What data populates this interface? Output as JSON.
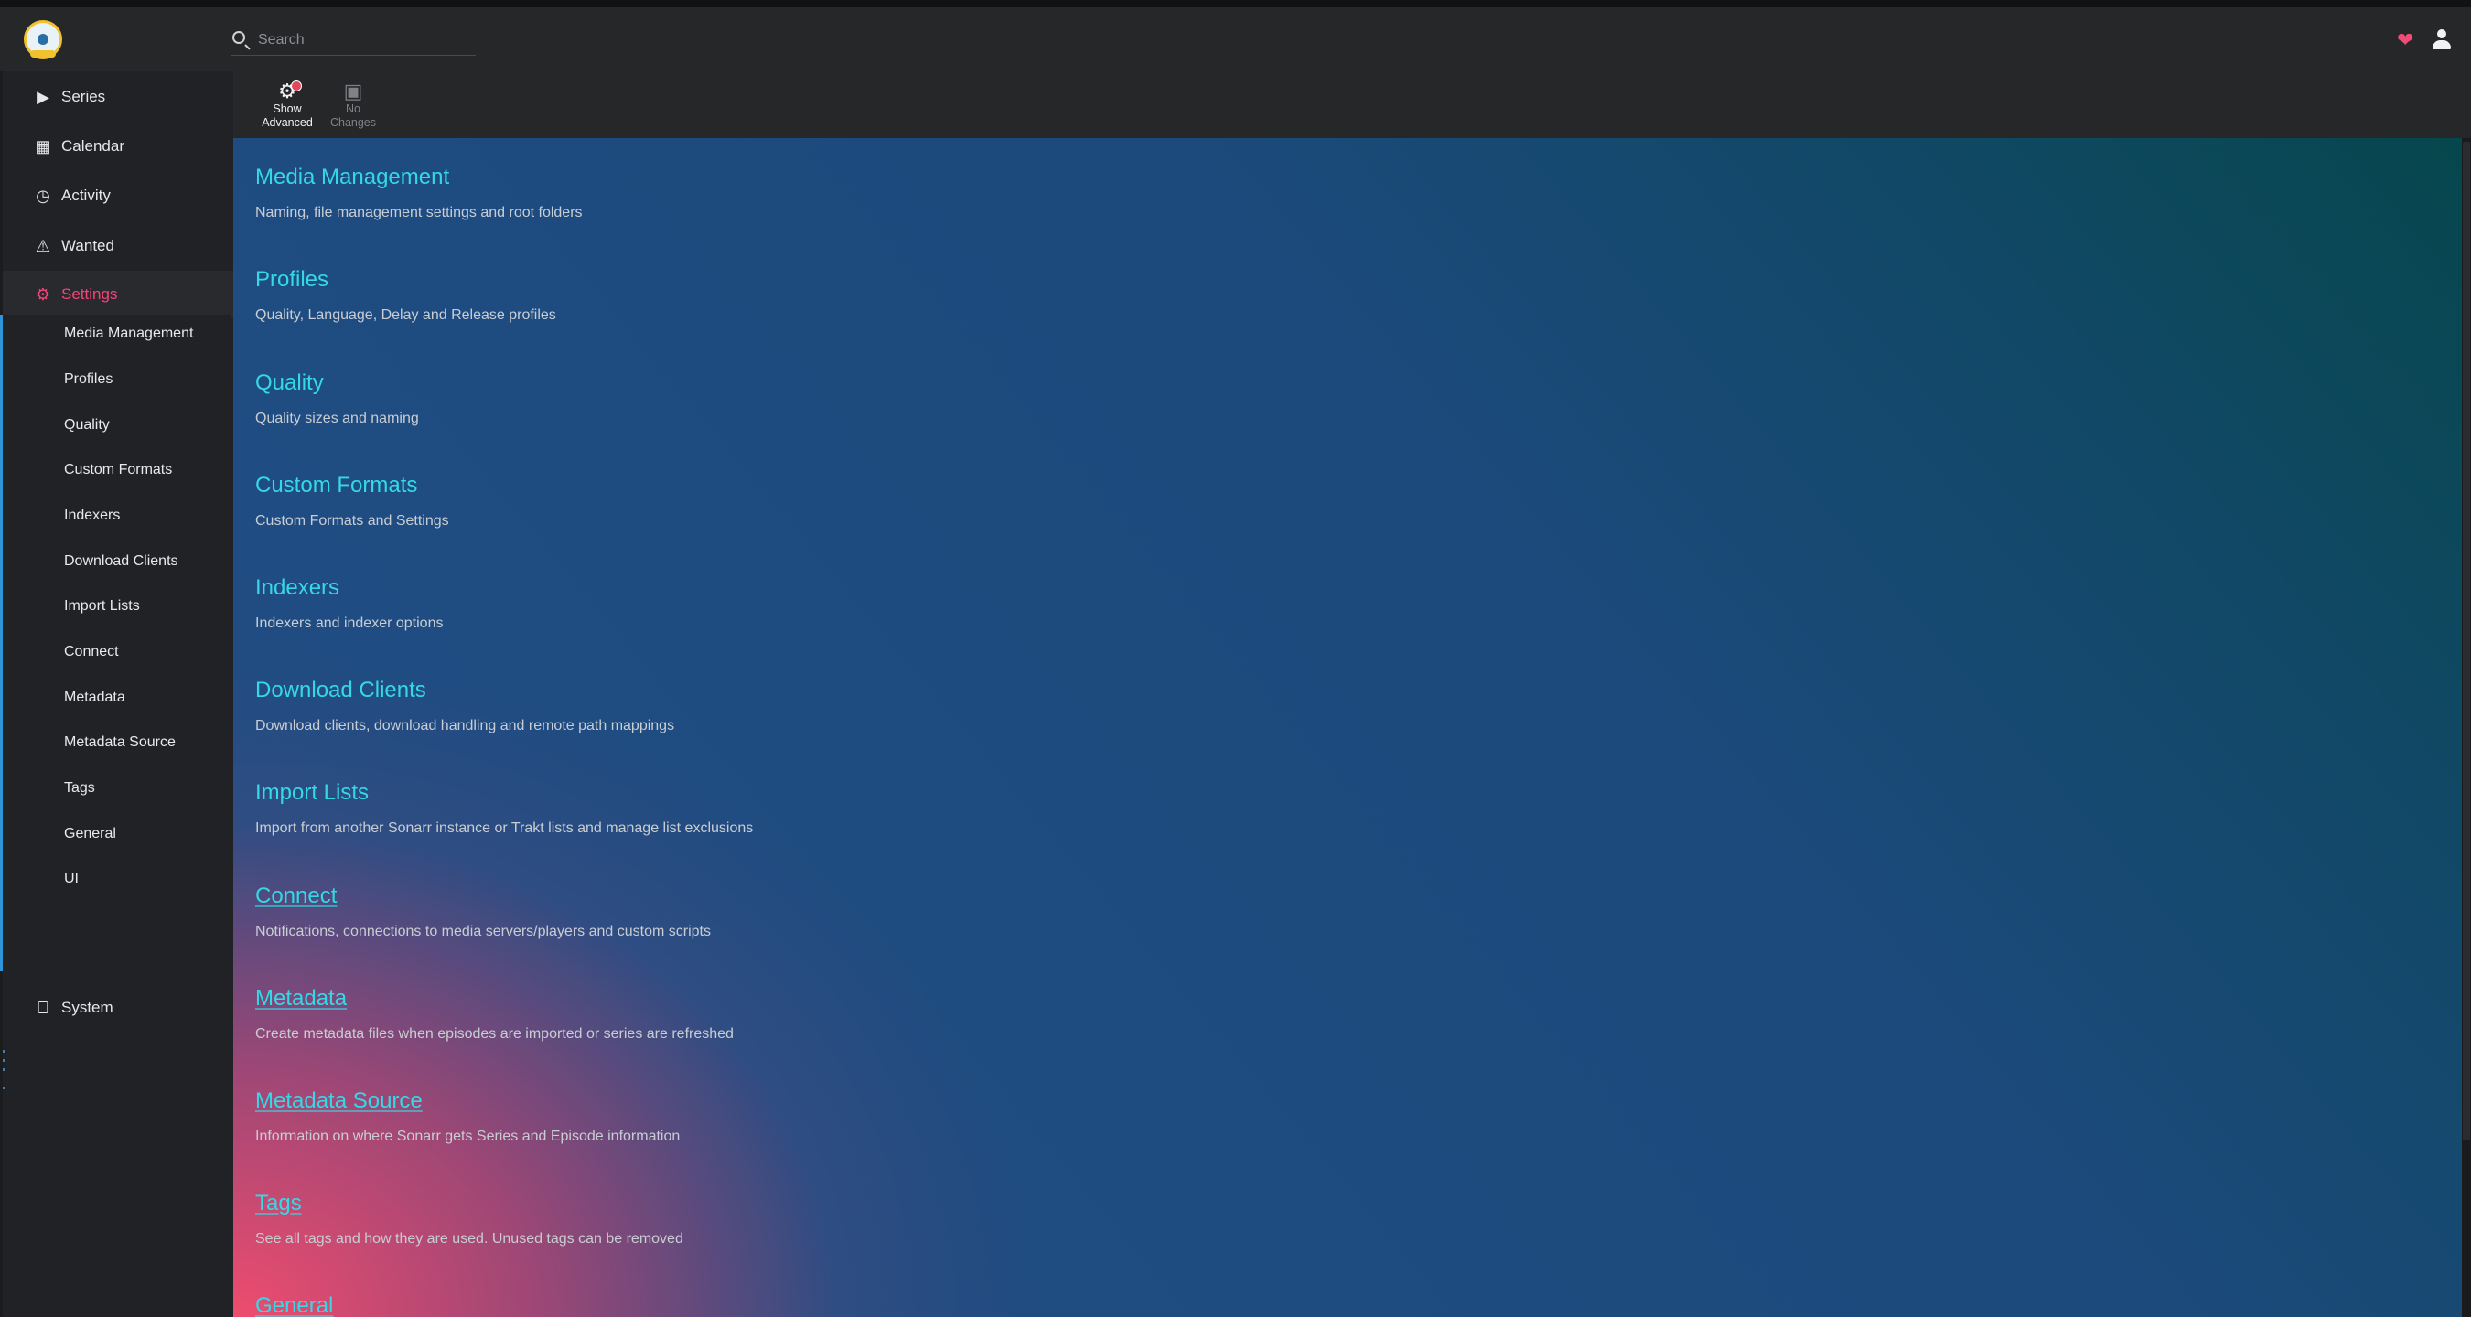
{
  "header": {
    "search_placeholder": "Search"
  },
  "sidebar": {
    "items": [
      {
        "label": "Series"
      },
      {
        "label": "Calendar"
      },
      {
        "label": "Activity"
      },
      {
        "label": "Wanted"
      },
      {
        "label": "Settings"
      },
      {
        "label": "System"
      }
    ],
    "settings_subitems": [
      "Media Management",
      "Profiles",
      "Quality",
      "Custom Formats",
      "Indexers",
      "Download Clients",
      "Import Lists",
      "Connect",
      "Metadata",
      "Metadata Source",
      "Tags",
      "General",
      "UI"
    ]
  },
  "toolbar": {
    "show_advanced": {
      "line1": "Show",
      "line2": "Advanced"
    },
    "no_changes": {
      "line1": "No",
      "line2": "Changes"
    }
  },
  "sections": [
    {
      "title": "Media Management",
      "desc": "Naming, file management settings and root folders"
    },
    {
      "title": "Profiles",
      "desc": "Quality, Language, Delay and Release profiles"
    },
    {
      "title": "Quality",
      "desc": "Quality sizes and naming"
    },
    {
      "title": "Custom Formats",
      "desc": "Custom Formats and Settings"
    },
    {
      "title": "Indexers",
      "desc": "Indexers and indexer options"
    },
    {
      "title": "Download Clients",
      "desc": "Download clients, download handling and remote path mappings"
    },
    {
      "title": "Import Lists",
      "desc": "Import from another Sonarr instance or Trakt lists and manage list exclusions"
    },
    {
      "title": "Connect",
      "desc": "Notifications, connections to media servers/players and custom scripts"
    },
    {
      "title": "Metadata",
      "desc": "Create metadata files when episodes are imported or series are refreshed"
    },
    {
      "title": "Metadata Source",
      "desc": "Information on where Sonarr gets Series and Episode information"
    },
    {
      "title": "Tags",
      "desc": "See all tags and how they are used. Unused tags can be removed"
    },
    {
      "title": "General",
      "desc": ""
    }
  ],
  "colors": {
    "accent": "#35d8e6",
    "active_nav": "#f5457a",
    "heart": "#f14c78"
  }
}
